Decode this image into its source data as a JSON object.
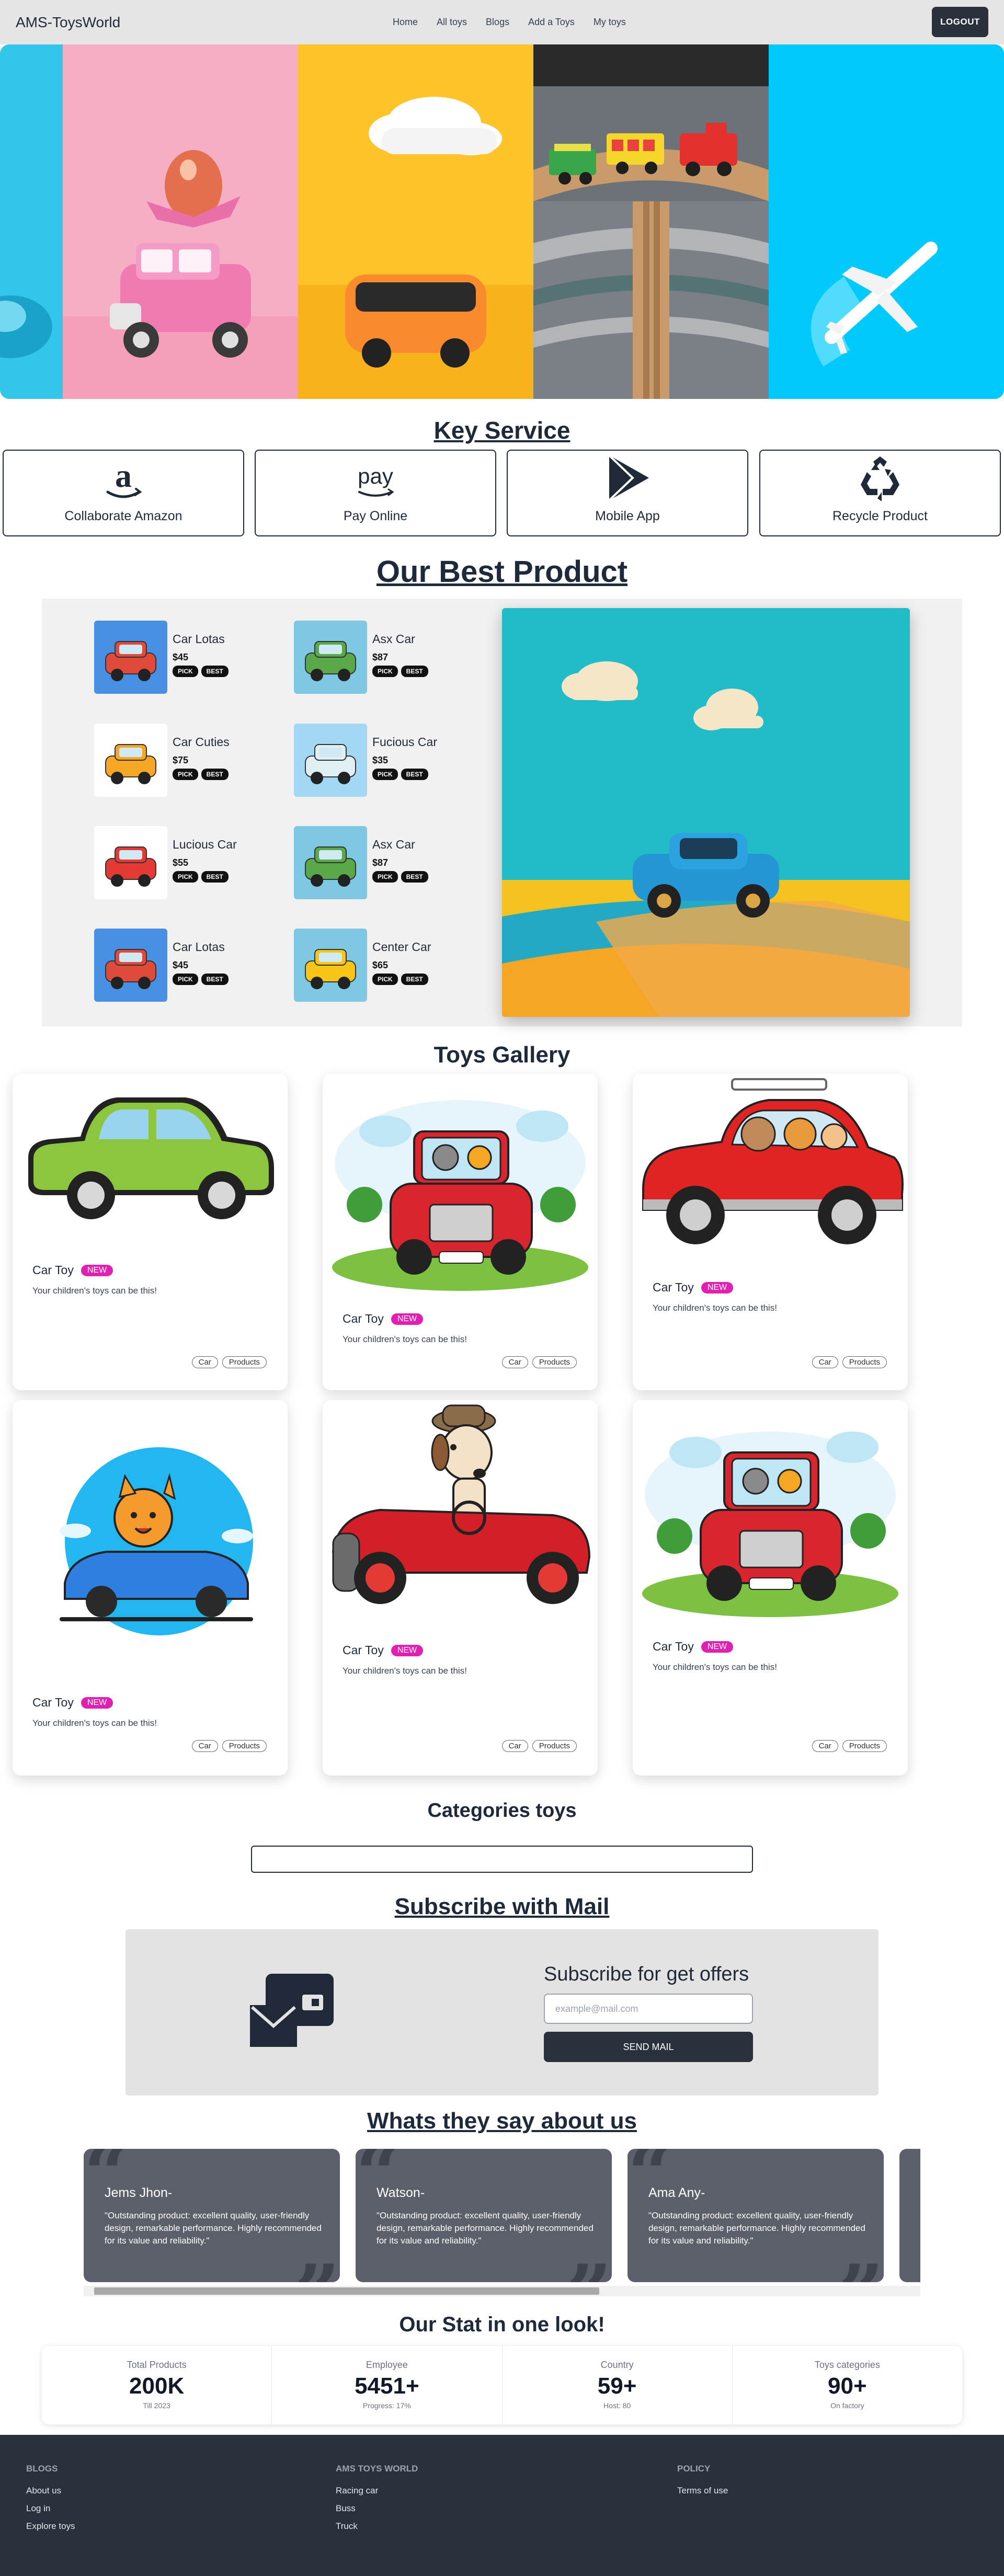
{
  "nav": {
    "brand": "AMS-ToysWorld",
    "links": [
      "Home",
      "All toys",
      "Blogs",
      "Add a Toys",
      "My toys"
    ],
    "logout": "LOGOUT"
  },
  "key_service": {
    "title": "Key Service",
    "items": [
      {
        "label": "Collaborate Amazon",
        "icon": "amazon-icon"
      },
      {
        "label": "Pay Online",
        "icon": "pay-icon"
      },
      {
        "label": "Mobile App",
        "icon": "play-store-icon"
      },
      {
        "label": "Recycle Product",
        "icon": "recycle-icon"
      }
    ]
  },
  "best_product": {
    "title": "Our Best Product",
    "products": [
      {
        "name": "Car Lotas",
        "price": "$45",
        "tags": [
          "PICK",
          "BEST"
        ],
        "bg": "#4a90e2",
        "car": "#e04a3a"
      },
      {
        "name": "Asx Car",
        "price": "$87",
        "tags": [
          "PICK",
          "BEST"
        ],
        "bg": "#7ec8e3",
        "car": "#5aa84a"
      },
      {
        "name": "Car Cuties",
        "price": "$75",
        "tags": [
          "PICK",
          "BEST"
        ],
        "bg": "#ffffff",
        "car": "#f5a623"
      },
      {
        "name": "Fucious Car",
        "price": "$35",
        "tags": [
          "PICK",
          "BEST"
        ],
        "bg": "#a3d8f4",
        "car": "#dfeff2"
      },
      {
        "name": "Lucious Car",
        "price": "$55",
        "tags": [
          "PICK",
          "BEST"
        ],
        "bg": "#ffffff",
        "car": "#e53935"
      },
      {
        "name": "Asx Car",
        "price": "$87",
        "tags": [
          "PICK",
          "BEST"
        ],
        "bg": "#7ec8e3",
        "car": "#5aa84a"
      },
      {
        "name": "Car Lotas",
        "price": "$45",
        "tags": [
          "PICK",
          "BEST"
        ],
        "bg": "#4a90e2",
        "car": "#e04a3a"
      },
      {
        "name": "Center Car",
        "price": "$65",
        "tags": [
          "PICK",
          "BEST"
        ],
        "bg": "#7ec8e3",
        "car": "#f5c518"
      }
    ]
  },
  "gallery": {
    "title": "Toys Gallery",
    "cards": [
      {
        "title": "Car Toy",
        "badge": "NEW",
        "desc": "Your children's toys can be this!",
        "chips": [
          "Car",
          "Products"
        ]
      },
      {
        "title": "Car Toy",
        "badge": "NEW",
        "desc": "Your children's toys can be this!",
        "chips": [
          "Car",
          "Products"
        ]
      },
      {
        "title": "Car Toy",
        "badge": "NEW",
        "desc": "Your children's toys can be this!",
        "chips": [
          "Car",
          "Products"
        ]
      },
      {
        "title": "Car Toy",
        "badge": "NEW",
        "desc": "Your children's toys can be this!",
        "chips": [
          "Car",
          "Products"
        ]
      },
      {
        "title": "Car Toy",
        "badge": "NEW",
        "desc": "Your children's toys can be this!",
        "chips": [
          "Car",
          "Products"
        ]
      },
      {
        "title": "Car Toy",
        "badge": "NEW",
        "desc": "Your children's toys can be this!",
        "chips": [
          "Car",
          "Products"
        ]
      }
    ]
  },
  "categories": {
    "title": "Categories toys"
  },
  "subscribe": {
    "title": "Subscribe with Mail",
    "heading": "Subscribe for get offers",
    "placeholder": "example@mail.com",
    "button": "SEND MAIL"
  },
  "testimonials": {
    "title": "Whats they say about us",
    "items": [
      {
        "name": "Jems Jhon-",
        "text": "\"Outstanding product: excellent quality, user-friendly design, remarkable performance. Highly recommended for its value and reliability.\""
      },
      {
        "name": "Watson-",
        "text": "\"Outstanding product: excellent quality, user-friendly design, remarkable performance. Highly recommended for its value and reliability.\""
      },
      {
        "name": "Ama Any-",
        "text": "\"Outstanding product: excellent quality, user-friendly design, remarkable performance. Highly recommended for its value and reliability.\""
      }
    ]
  },
  "stats": {
    "title": "Our Stat in one look!",
    "items": [
      {
        "title": "Total Products",
        "value": "200K",
        "desc": "Till 2023"
      },
      {
        "title": "Employee",
        "value": "5451+",
        "desc": "Progress: 17%"
      },
      {
        "title": "Country",
        "value": "59+",
        "desc": "Host: 80"
      },
      {
        "title": "Toys categories",
        "value": "90+",
        "desc": "On factory"
      }
    ]
  },
  "footer": {
    "cols": [
      {
        "heading": "BLOGS",
        "links": [
          "About us",
          "Log in",
          "Explore toys"
        ]
      },
      {
        "heading": "AMS TOYS WORLD",
        "links": [
          "Racing car",
          "Buss",
          "Truck"
        ]
      },
      {
        "heading": "POLICY",
        "links": [
          "Terms of use"
        ]
      }
    ]
  }
}
